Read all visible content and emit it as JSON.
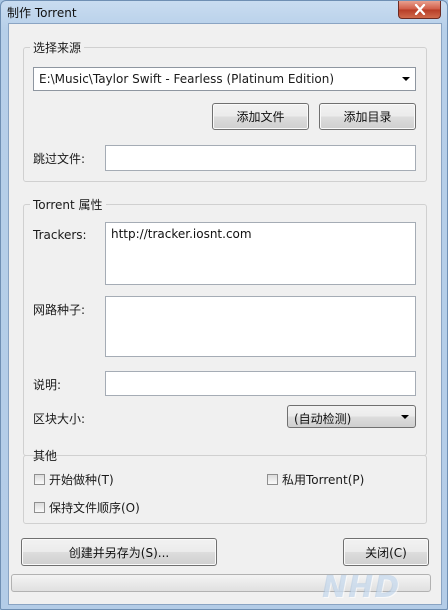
{
  "window": {
    "title": "制作 Torrent"
  },
  "source": {
    "group_label": "选择来源",
    "selected_path": "E:\\Music\\Taylor Swift - Fearless (Platinum Edition)",
    "add_file_label": "添加文件",
    "add_dir_label": "添加目录",
    "skip_files_label": "跳过文件:",
    "skip_files_value": ""
  },
  "properties": {
    "group_label": "Torrent 属性",
    "trackers_label": "Trackers:",
    "trackers_value": "http://tracker.iosnt.com",
    "web_seeds_label": "网路种子:",
    "web_seeds_value": "",
    "comment_label": "说明:",
    "comment_value": "",
    "piece_size_label": "区块大小:",
    "piece_size_value": "(自动检测)"
  },
  "other": {
    "group_label": "其他",
    "start_seeding_label": "开始做种(T)",
    "start_seeding_checked": false,
    "private_torrent_label": "私用Torrent(P)",
    "private_torrent_checked": false,
    "preserve_order_label": "保持文件顺序(O)",
    "preserve_order_checked": false
  },
  "actions": {
    "create_save_label": "创建并另存为(S)...",
    "close_label": "关闭(C)"
  },
  "progress": 0,
  "watermark": "NHD"
}
